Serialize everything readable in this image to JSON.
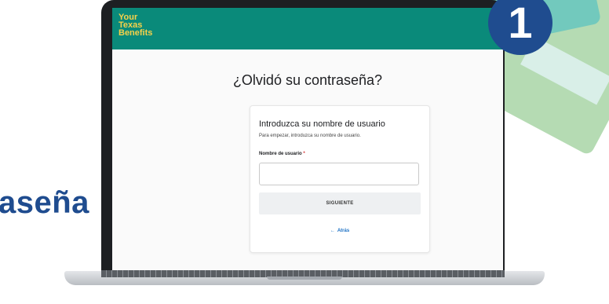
{
  "badge": {
    "step_number": "1"
  },
  "side_text": "aseña",
  "app": {
    "logo_lines": [
      "Your",
      "Texas",
      "Benefits"
    ],
    "header_color": "#0a8a7a",
    "logo_color": "#f5d14a"
  },
  "page": {
    "title": "¿Olvidó su contraseña?"
  },
  "card": {
    "title": "Introduzca su nombre de usuario",
    "subtitle": "Para empezar, introduzca su nombre de usuario.",
    "field_label": "Nombre de usuario",
    "required_mark": "*",
    "field_value": "",
    "next_label": "SIGUIENTE",
    "back_arrow": "←",
    "back_label": "Atrás"
  },
  "icons": {
    "back": "arrow-left-icon"
  }
}
